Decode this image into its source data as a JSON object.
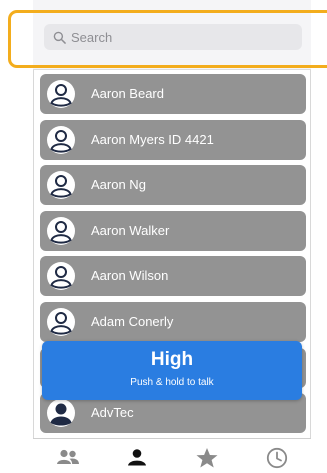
{
  "search": {
    "placeholder": "Search"
  },
  "contacts": [
    {
      "name": "Aaron Beard",
      "avatar": "person-outline-icon"
    },
    {
      "name": "Aaron Myers ID 4421",
      "avatar": "person-outline-icon"
    },
    {
      "name": "Aaron Ng",
      "avatar": "person-outline-icon"
    },
    {
      "name": "Aaron Walker",
      "avatar": "person-outline-icon"
    },
    {
      "name": "Aaron Wilson",
      "avatar": "person-outline-icon"
    },
    {
      "name": "Adam Conerly",
      "avatar": "person-outline-icon"
    },
    {
      "name": "",
      "avatar": "person-outline-icon"
    },
    {
      "name": "AdvTec",
      "avatar": "person-filled-icon"
    }
  ],
  "ptt": {
    "level": "High",
    "hint": "Push & hold to talk"
  },
  "tabs": [
    {
      "icon": "group-icon",
      "active": false
    },
    {
      "icon": "person-icon",
      "active": true
    },
    {
      "icon": "star-icon",
      "active": false
    },
    {
      "icon": "clock-icon",
      "active": false
    }
  ],
  "colors": {
    "highlight": "#f3ad1d",
    "contact_bg": "#939393",
    "ptt_bg": "#2a7de1",
    "tab_inactive": "#8a8a8a",
    "tab_active": "#111111"
  }
}
